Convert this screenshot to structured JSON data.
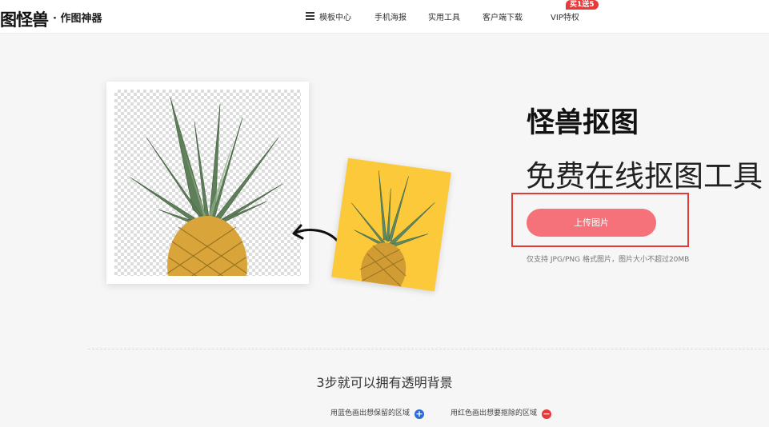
{
  "header": {
    "logo": "图怪兽",
    "logo_sub": "· 作图神器",
    "nav": {
      "templates": "模板中心",
      "poster": "手机海报",
      "tools": "实用工具",
      "download": "客户端下载",
      "vip": "VIP特权",
      "vip_badge": "买1送5"
    }
  },
  "hero": {
    "title": "怪兽抠图",
    "subtitle": "免费在线抠图工具",
    "upload_label": "上传图片",
    "hint": "仅支持 JPG/PNG 格式图片，图片大小不超过20MB"
  },
  "steps": {
    "title": "3步就可以拥有透明背景",
    "step1": "用蓝色画出想保留的区域",
    "step2": "用红色画出想要抠除的区域"
  },
  "colors": {
    "accent": "#f5727a",
    "highlight": "#e53935",
    "blue": "#2f6bd8",
    "red": "#e53a3a",
    "badge": "#e83a3a"
  },
  "icons": {
    "menu": "menu-icon",
    "plus": "plus-circle-icon",
    "minus": "minus-circle-icon",
    "arrow": "curved-arrow-icon"
  }
}
